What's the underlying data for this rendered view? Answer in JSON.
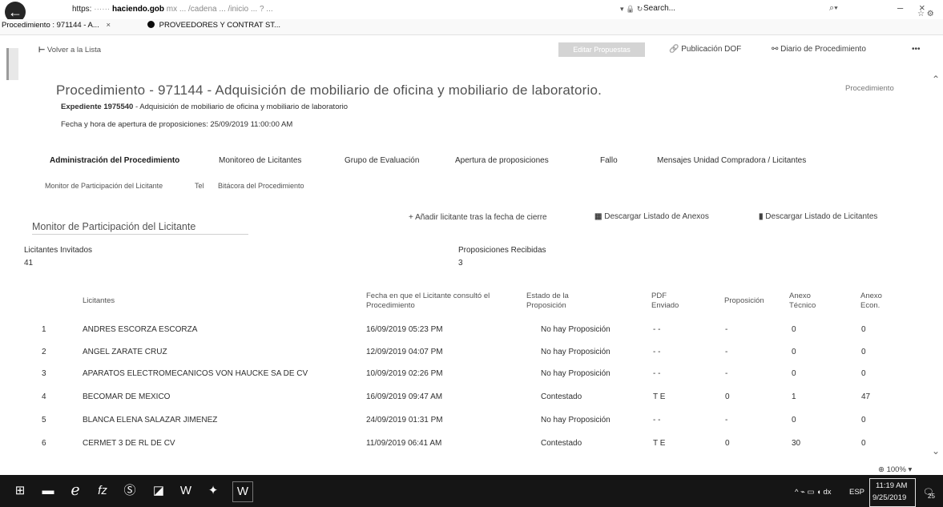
{
  "browser": {
    "url_prefix": "https:",
    "url_domain": "haciendo.gob",
    "url_rest": "mx ... /cadena ... /inicio ... ?  ...",
    "search_placeholder": "Search...",
    "tab_active": "Procedimiento : 971144 - A...",
    "tab_active_close": "×",
    "tab_second": "PROVEEDORES Y CONTRAT ST..."
  },
  "toolbar": {
    "back_link": "Volver a la Lista",
    "button_label": "Editar Propuestas",
    "publication_link": "Publicación DOF",
    "diary_link": "Diario de Procedimiento",
    "more": "•••"
  },
  "header": {
    "title": "Procedimiento - 971144 - Adquisición de mobiliario de oficina y mobiliario de laboratorio.",
    "right_link": "Procedimiento",
    "expediente_label": "Expediente 1975540",
    "expediente_text": "- Adquisición de mobiliario de oficina y mobiliario de laboratorio",
    "fecha": "Fecha y hora de apertura de proposiciones: 25/09/2019 11:00:00 AM"
  },
  "main_tabs": [
    "Administración del Procedimiento",
    "Monitoreo de Licitantes",
    "Grupo de Evaluación",
    "Apertura de proposiciones",
    "Fallo",
    "Mensajes Unidad Compradora / Licitantes"
  ],
  "sub_tabs": [
    "Monitor de Participación del Licitante",
    "Bitácora del Procedimiento"
  ],
  "sub_tab_mid": "Tel",
  "section": {
    "title": "Monitor de Participación del Licitante",
    "action_add": "Añadir licitante tras la fecha de cierre",
    "action_download_annex": "Descargar Listado de Anexos",
    "action_download_bidders": "Descargar Listado de Licitantes"
  },
  "stats": {
    "invited_label": "Licitantes Invitados",
    "invited_value": "41",
    "received_label": "Proposiciones Recibidas",
    "received_value": "3"
  },
  "table": {
    "headers": [
      "Licitantes",
      "Fecha en que el Licitante consultó el Procedimiento",
      "Estado de la Proposición",
      "PDF Enviado",
      "Proposición",
      "Anexo Técnico",
      "Anexo Econ."
    ],
    "rows": [
      [
        "1",
        "ANDRES ESCORZA ESCORZA",
        "16/09/2019 05:23 PM",
        "No hay Proposición",
        "- -",
        "-",
        "0",
        "0"
      ],
      [
        "2",
        "ANGEL ZARATE CRUZ",
        "12/09/2019 04:07 PM",
        "No hay Proposición",
        "- -",
        "-",
        "0",
        "0"
      ],
      [
        "3",
        "APARATOS ELECTROMECANICOS VON HAUCKE SA DE CV",
        "10/09/2019 02:26 PM",
        "No hay Proposición",
        "- -",
        "-",
        "0",
        "0"
      ],
      [
        "4",
        "BECOMAR DE MEXICO",
        "16/09/2019 09:47 AM",
        "Contestado",
        "T E",
        "0",
        "1",
        "47"
      ],
      [
        "5",
        "BLANCA ELENA SALAZAR JIMENEZ",
        "24/09/2019 01:31 PM",
        "No hay Proposición",
        "- -",
        "-",
        "0",
        "0"
      ],
      [
        "6",
        "CERMET 3 DE RL DE CV",
        "11/09/2019 06:41 AM",
        "Contestado",
        "T E",
        "0",
        "30",
        "0"
      ]
    ]
  },
  "zoom": "100%",
  "taskbar": {
    "lang": "ESP",
    "time": "11:19 AM",
    "date": "9/25/2019",
    "notif": "25"
  }
}
